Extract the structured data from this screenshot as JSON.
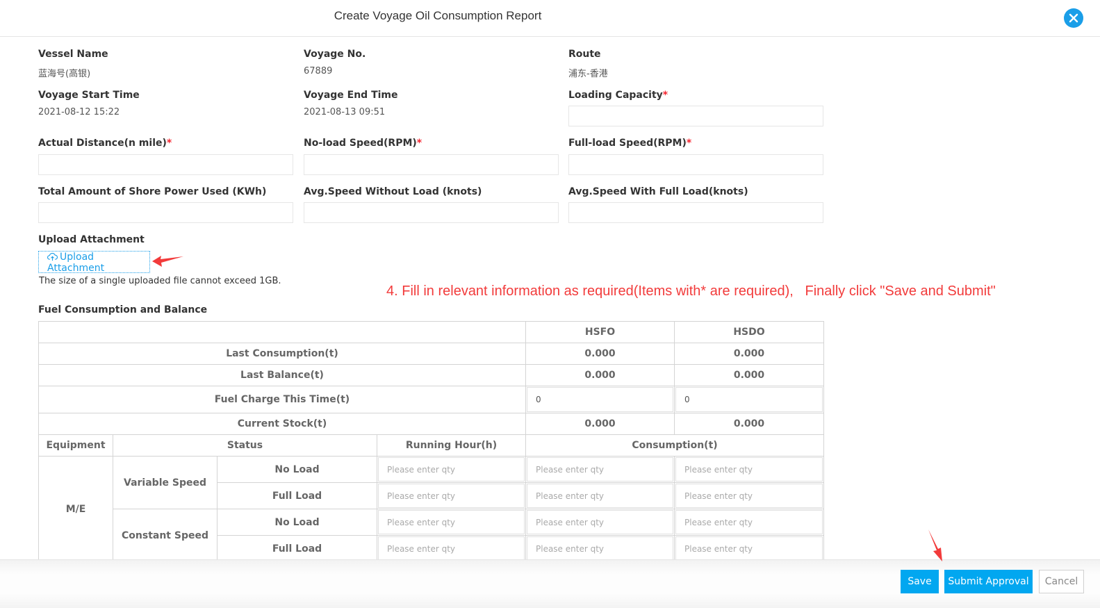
{
  "header": {
    "title": "Create Voyage Oil Consumption Report",
    "close_icon": "close-icon"
  },
  "form": {
    "vessel_name": {
      "label": "Vessel Name",
      "value": "蓝海号(高银)"
    },
    "voyage_no": {
      "label": "Voyage No.",
      "value": "67889"
    },
    "route": {
      "label": "Route",
      "value": "浦东-香港"
    },
    "voyage_start_time": {
      "label": "Voyage Start Time",
      "value": "2021-08-12 15:22"
    },
    "voyage_end_time": {
      "label": "Voyage End Time",
      "value": "2021-08-13 09:51"
    },
    "loading_capacity": {
      "label": "Loading Capacity",
      "required_mark": "*",
      "value": ""
    },
    "actual_distance": {
      "label": "Actual Distance(n mile)",
      "required_mark": "*",
      "value": ""
    },
    "no_load_speed": {
      "label": "No-load Speed(RPM)",
      "required_mark": "*",
      "value": ""
    },
    "full_load_speed": {
      "label": "Full-load Speed(RPM)",
      "required_mark": "*",
      "value": ""
    },
    "shore_power": {
      "label": "Total Amount of Shore Power Used (KWh)",
      "value": ""
    },
    "avg_speed_no_load": {
      "label": "Avg.Speed Without Load (knots)",
      "value": ""
    },
    "avg_speed_full_load": {
      "label": "Avg.Speed With Full Load(knots)",
      "value": ""
    }
  },
  "upload": {
    "label": "Upload Attachment",
    "button_label": "Upload Attachment",
    "icon": "cloud-upload-icon",
    "note": "The size of a single uploaded file cannot exceed 1GB."
  },
  "instruction": {
    "text": "4. Fill in relevant information as required(Items with* are required),   Finally click \"Save and Submit\"",
    "color": "#f23b3b"
  },
  "fuel": {
    "title": "Fuel Consumption and Balance",
    "fuel_types": [
      "HSFO",
      "HSDO"
    ],
    "summary_rows": [
      {
        "label": "Last Consumption(t)",
        "hsfo": "0.000",
        "hsdo": "0.000"
      },
      {
        "label": "Last Balance(t)",
        "hsfo": "0.000",
        "hsdo": "0.000"
      },
      {
        "label": "Fuel Charge This Time(t)",
        "hsfo": "0",
        "hsdo": "0"
      },
      {
        "label": "Current Stock(t)",
        "hsfo": "0.000",
        "hsdo": "0.000"
      }
    ],
    "headers": {
      "equipment": "Equipment",
      "status": "Status",
      "running_hour": "Running Hour(h)",
      "consumption": "Consumption(t)"
    },
    "equipment": "M/E",
    "modes": [
      {
        "name": "Variable Speed",
        "loads": [
          "No Load",
          "Full Load"
        ]
      },
      {
        "name": "Constant Speed",
        "loads": [
          "No Load",
          "Full Load"
        ]
      }
    ],
    "qty_placeholder": "Please enter qty"
  },
  "footer": {
    "save_label": "Save",
    "submit_label": "Submit Approval",
    "cancel_label": "Cancel"
  },
  "colors": {
    "primary": "#02a7f0",
    "close": "#1a9ee8",
    "required": "#f5222d",
    "annotation": "#f23b3b"
  }
}
